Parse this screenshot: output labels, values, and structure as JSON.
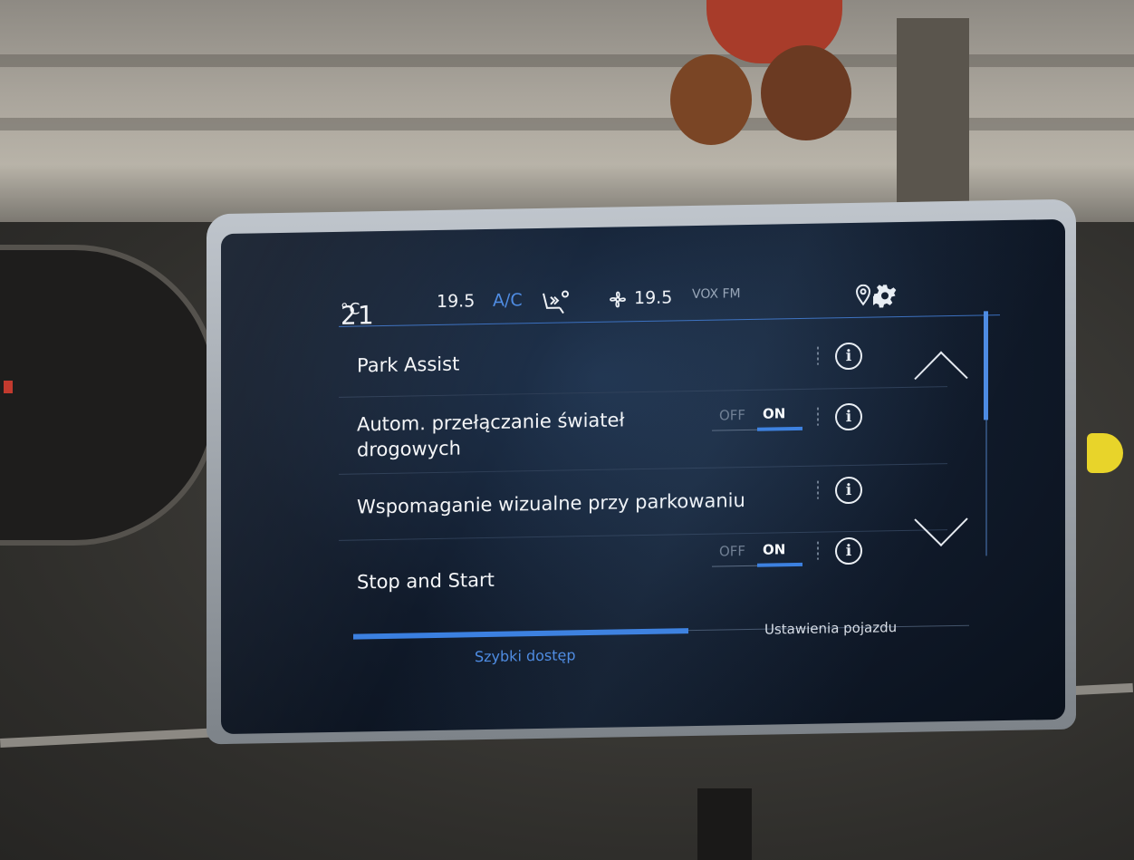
{
  "status_bar": {
    "temp_driver": "21",
    "temp_unit": "°C",
    "temp_left": "19.5",
    "ac_label": "A/C",
    "temp_right": "19.5",
    "radio_station": "VOX FM",
    "icons": [
      "seat-airflow-icon",
      "fan-icon",
      "location-pin-icon",
      "gear-icon"
    ]
  },
  "settings": {
    "items": [
      {
        "label": "Park Assist",
        "has_toggle": false
      },
      {
        "label": "Autom. przełączanie świateł drogowych",
        "has_toggle": true,
        "off_label": "OFF",
        "on_label": "ON",
        "state": "ON"
      },
      {
        "label": "Wspomaganie wizualne przy parkowaniu",
        "has_toggle": false
      },
      {
        "label": "Stop and Start",
        "has_toggle": true,
        "off_label": "OFF",
        "on_label": "ON",
        "state": "ON"
      }
    ],
    "info_glyph": "i"
  },
  "tabs": {
    "quick_access": "Szybki dostęp",
    "vehicle_settings": "Ustawienia pojazdu",
    "active": "Szybki dostęp"
  },
  "colors": {
    "accent_blue": "#3a7fe0",
    "screen_bg": "#101a2a",
    "text": "#f2f4f7"
  }
}
